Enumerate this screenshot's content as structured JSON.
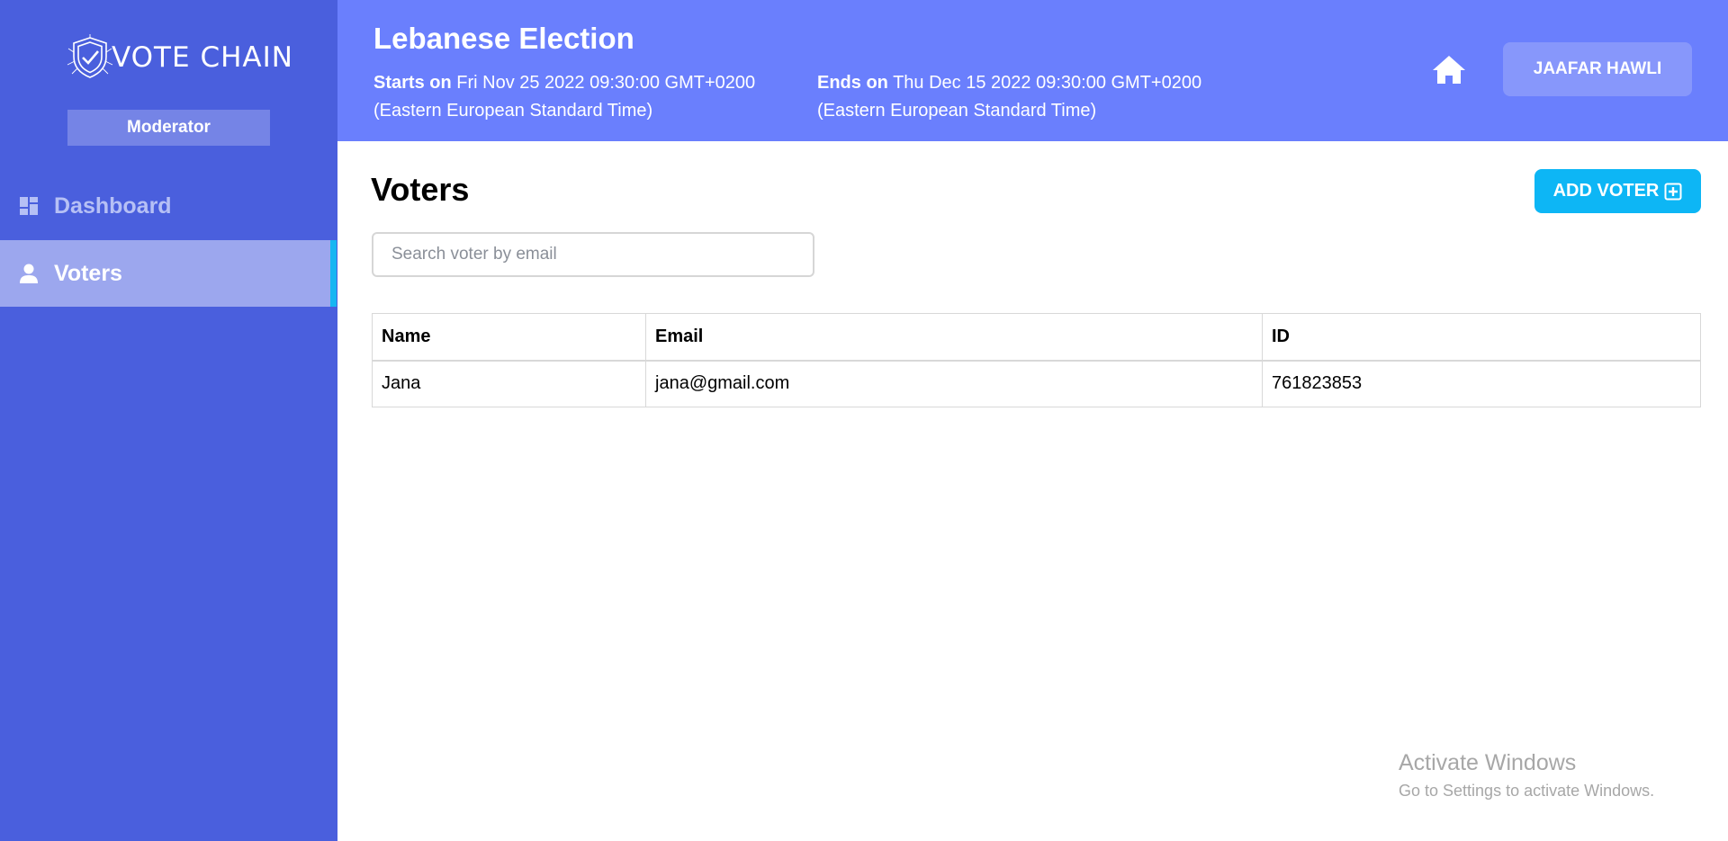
{
  "sidebar": {
    "logo_text": "VOTE CHAIN",
    "role": "Moderator",
    "items": [
      {
        "label": "Dashboard",
        "icon": "dashboard-icon",
        "active": false
      },
      {
        "label": "Voters",
        "icon": "user-icon",
        "active": true
      }
    ]
  },
  "header": {
    "title": "Lebanese Election",
    "start_label": "Starts on",
    "start_value": "Fri Nov 25 2022 09:30:00 GMT+0200",
    "start_tz": "(Eastern European Standard Time)",
    "end_label": "Ends on",
    "end_value": "Thu Dec 15 2022 09:30:00 GMT+0200",
    "end_tz": "(Eastern European Standard Time)",
    "user_name": "JAAFAR HAWLI"
  },
  "main": {
    "title": "Voters",
    "add_button": "ADD VOTER",
    "search_placeholder": "Search voter by email",
    "table": {
      "headers": [
        "Name",
        "Email",
        "ID"
      ],
      "rows": [
        [
          "Jana",
          "jana@gmail.com",
          "761823853"
        ]
      ]
    }
  },
  "watermark": {
    "title": "Activate Windows",
    "subtitle": "Go to Settings to activate Windows."
  },
  "colors": {
    "sidebar": "#4a5fdd",
    "header": "#6a7ffd",
    "accent": "#18b6f2",
    "add_button": "#0db6f5"
  }
}
